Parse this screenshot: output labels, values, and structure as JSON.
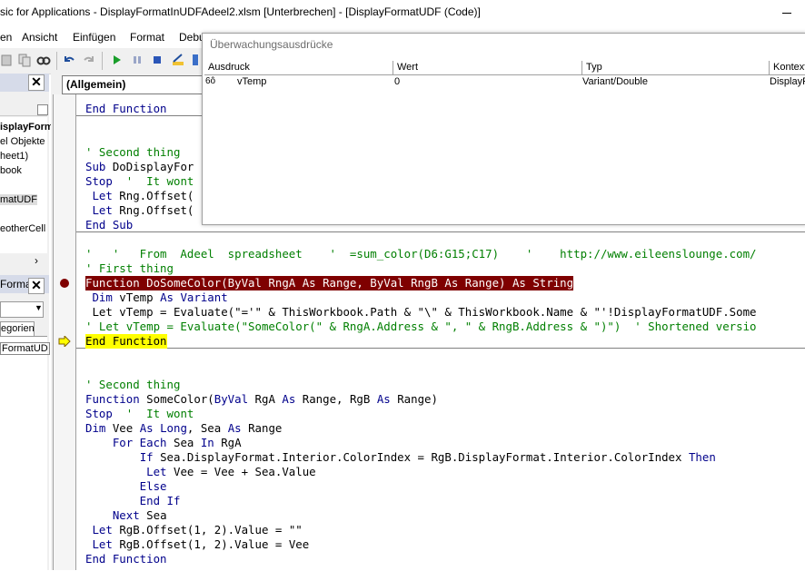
{
  "window": {
    "title": "sic for Applications - DisplayFormatInUDFAdeel2.xlsm [Unterbrechen] - [DisplayFormatUDF (Code)]"
  },
  "menu": {
    "items": [
      "en",
      "Ansicht",
      "Einfügen",
      "Format",
      "Debu"
    ]
  },
  "left_pane": {
    "project_items": [
      "isplayForm",
      "el Objekte",
      "heet1)",
      "book",
      "matUDF",
      "eotherCell"
    ],
    "properties_title": "Forma",
    "properties_object": "FormatUD",
    "properties_tab": "egorien"
  },
  "code_window": {
    "object_combo": "(Allgemein)"
  },
  "watch": {
    "title": "Überwachungsausdrücke",
    "columns": [
      "Ausdruck",
      "Wert",
      "Typ",
      "Kontext"
    ],
    "rows": [
      {
        "expression": "vTemp",
        "value": "0",
        "type": "Variant/Double",
        "context": "DisplayF"
      }
    ]
  },
  "code_top": [
    "End Function",
    "",
    "",
    "' Second thing",
    "Sub DoDisplayFor",
    "Stop  '  It wont",
    " Let Rng.Offset(",
    " Let Rng.Offset(",
    "End Sub"
  ],
  "code_bottom": {
    "comment_line": "'   '   From  Adeel  spreadsheet    '  =sum_color(D6:G15;C17)    '    http://www.eileenslounge.com/",
    "first_thing": "' First thing",
    "function_line": "Function DoSomeColor(ByVal RngA As Range, ByVal RngB As Range) As String",
    "dim_line": " Dim vTemp As Variant",
    "let_line": " Let vTemp = Evaluate(\"='\" & ThisWorkbook.Path & \"\\\" & ThisWorkbook.Name & \"'!DisplayFormatUDF.Some",
    "let_comment": "' Let vTemp = Evaluate(\"SomeColor(\" & RngA.Address & \", \" & RngB.Address & \")\")  ' Shortened versio",
    "end_function_current": "End Function",
    "second_thing": "' Second thing",
    "function2": "Function SomeColor(ByVal RgA As Range, RgB As Range)",
    "stop_line": "Stop  '  It wont",
    "dim2": "Dim Vee As Long, Sea As Range",
    "for_each": "    For Each Sea In RgA",
    "if_line": "        If Sea.DisplayFormat.Interior.ColorIndex = RgB.DisplayFormat.Interior.ColorIndex Then",
    "let_vee": "         Let Vee = Vee + Sea.Value",
    "else_line": "        Else",
    "endif_line": "        End If",
    "next_line": "    Next Sea",
    "let_offset1": " Let RgB.Offset(1, 2).Value = \"\"",
    "let_offset2": " Let RgB.Offset(1, 2).Value = Vee",
    "end_function": "End Function"
  },
  "colors": {
    "breakpoint": "#7f0000",
    "current_line": "#ffff00",
    "keyword": "#00008b",
    "comment": "#007f00"
  }
}
